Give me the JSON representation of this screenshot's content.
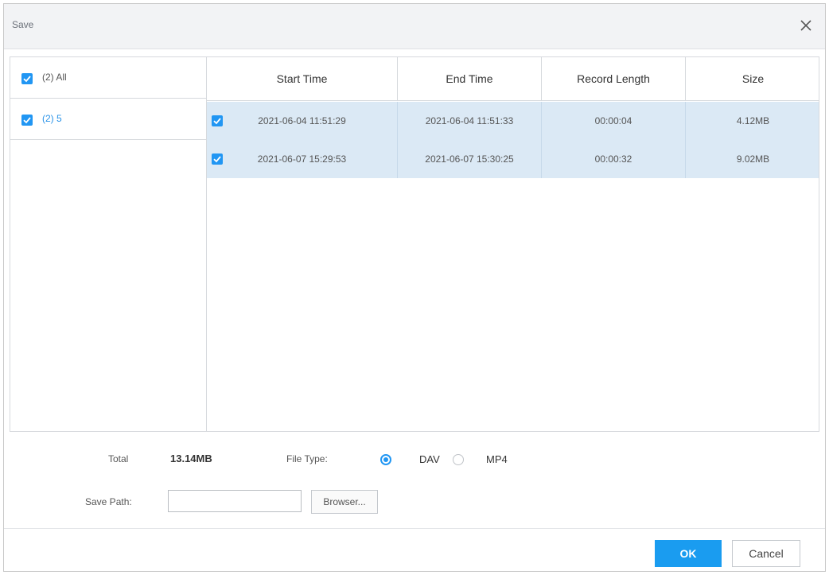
{
  "dialog": {
    "title": "Save",
    "close_icon": "close-icon"
  },
  "tree": {
    "items": [
      {
        "label": "(2) All",
        "checked": true
      },
      {
        "label": "(2) 5",
        "checked": true
      }
    ]
  },
  "table": {
    "columns": [
      "Start Time",
      "End Time",
      "Record Length",
      "Size"
    ],
    "rows": [
      {
        "checked": true,
        "start": "2021-06-04 11:51:29",
        "end": "2021-06-04 11:51:33",
        "length": "00:00:04",
        "size": "4.12MB"
      },
      {
        "checked": true,
        "start": "2021-06-07 15:29:53",
        "end": "2021-06-07 15:30:25",
        "length": "00:00:32",
        "size": "9.02MB"
      }
    ]
  },
  "form": {
    "total_label": "Total",
    "total_value": "13.14MB",
    "file_type_label": "File Type:",
    "file_types": [
      {
        "label": "DAV",
        "selected": true
      },
      {
        "label": "MP4",
        "selected": false
      }
    ],
    "save_path_label": "Save Path:",
    "save_path_value": "",
    "browse_label": "Browser..."
  },
  "buttons": {
    "ok": "OK",
    "cancel": "Cancel"
  },
  "colors": {
    "accent": "#1a9cf0",
    "selected_row": "#dbe9f5",
    "checkbox": "#2196f3",
    "tree_link": "#2a93e8"
  }
}
